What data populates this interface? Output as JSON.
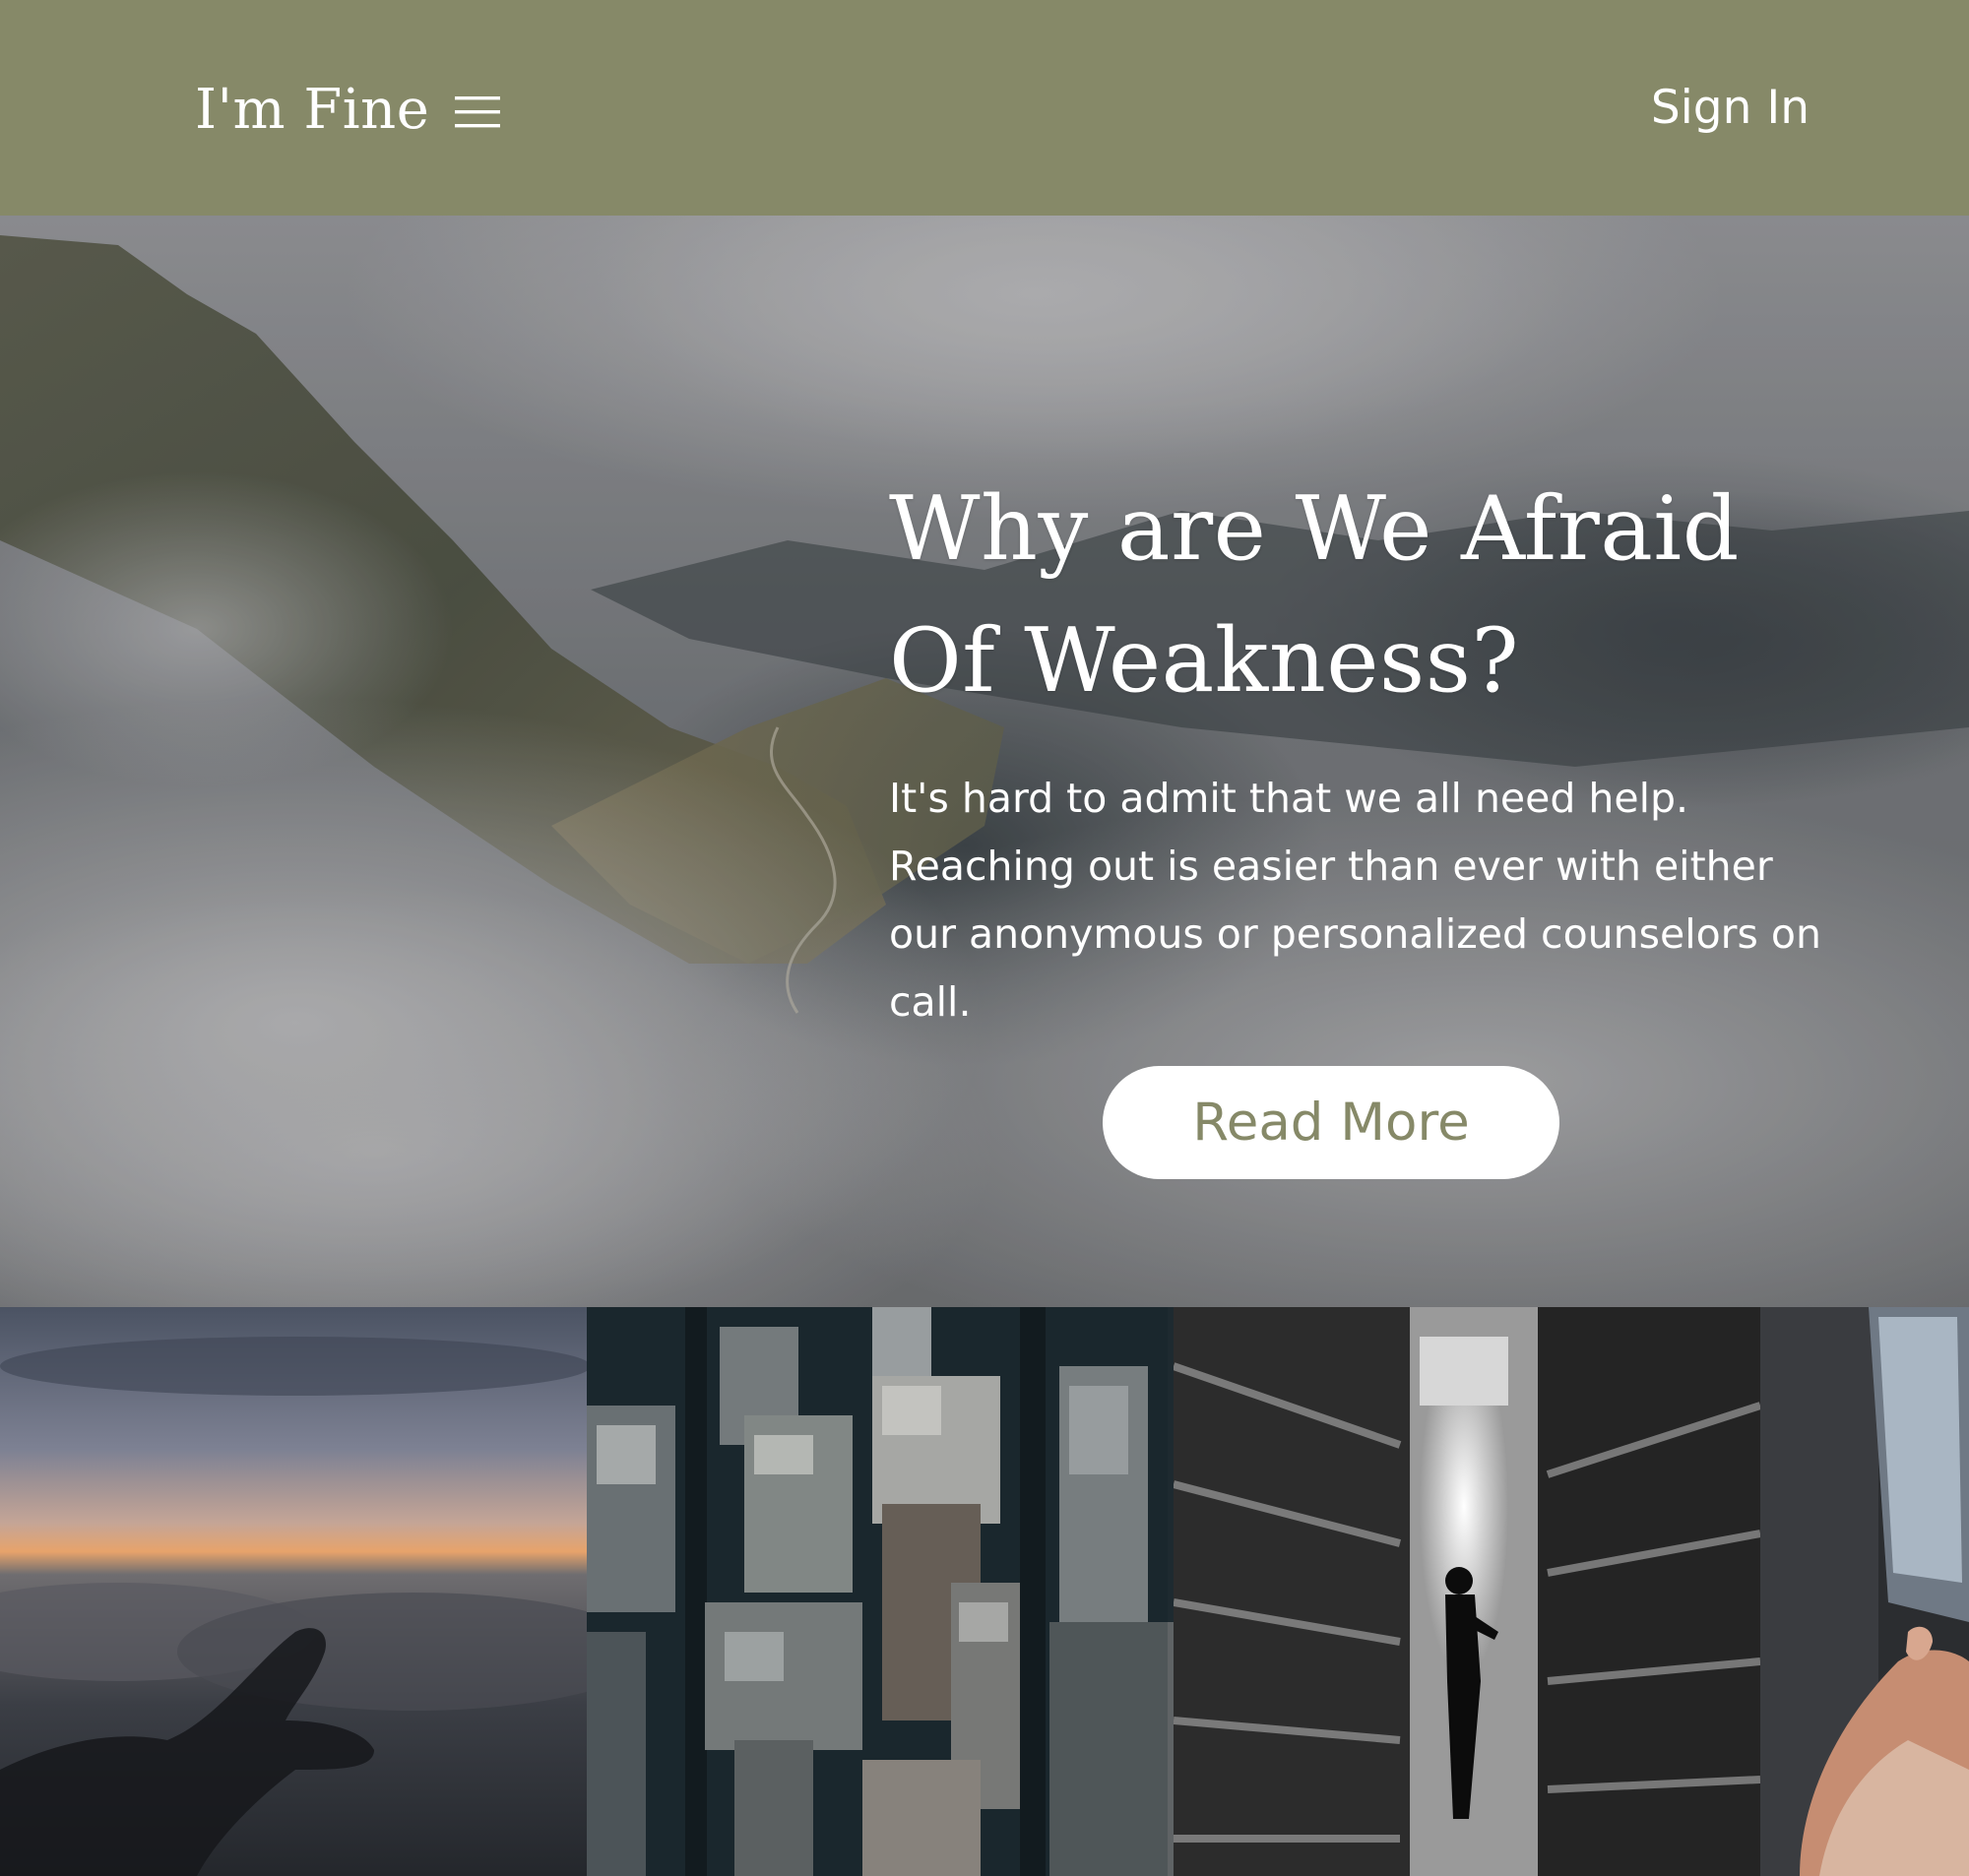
{
  "header": {
    "brand": "I'm Fine",
    "menu_icon": "hamburger-menu-icon",
    "signin_label": "Sign In",
    "background_color": "#868968"
  },
  "hero": {
    "title_line1": "Why are We Afraid",
    "title_line2": "Of Weakness?",
    "description": "It's hard to admit that we all need help. Reaching out is easier than ever with either our anonymous or personalized counselors on call.",
    "button_label": "Read More",
    "button_text_color": "#868968"
  },
  "gallery": [
    {
      "name": "sunset-clouds-hand-image"
    },
    {
      "name": "aerial-city-buildings-image"
    },
    {
      "name": "library-aisle-person-image"
    },
    {
      "name": "hands-holding-photos-image"
    }
  ]
}
